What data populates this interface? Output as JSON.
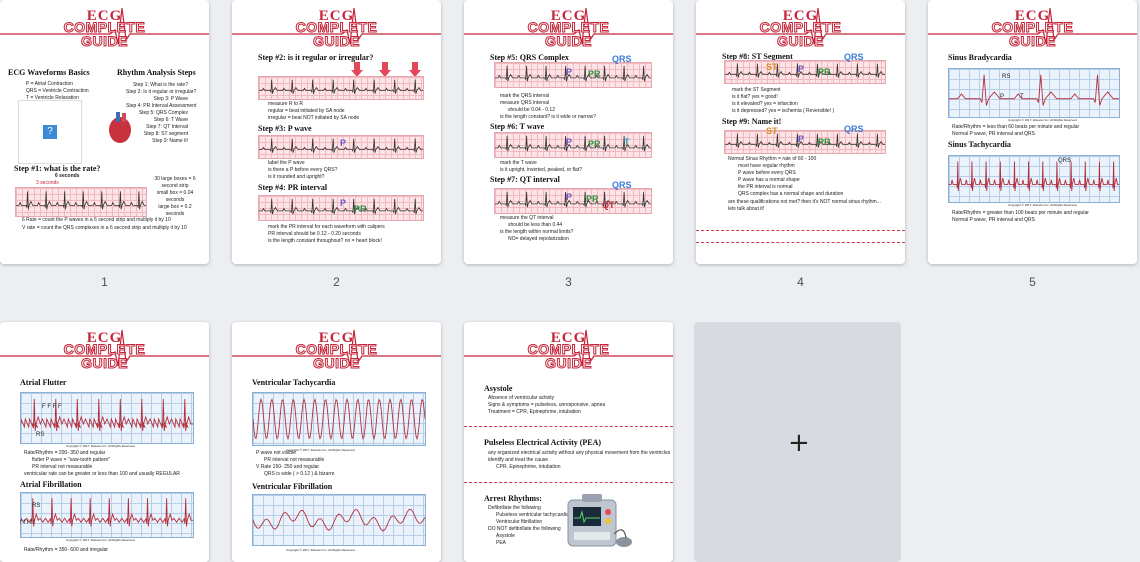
{
  "header": {
    "ecg": "ECG",
    "complete": "COMPLETE",
    "guide": "GUIDE"
  },
  "page_numbers": [
    "1",
    "2",
    "3",
    "4",
    "5"
  ],
  "add_page": {
    "icon": "plus-icon",
    "symbol": "+"
  },
  "colors": {
    "accent": "#c5263a",
    "background": "#eceef2",
    "add_tile": "#d7dbe1"
  },
  "p1": {
    "left_title": "ECG Waveforms Basics",
    "left_lines": [
      "P = Atrial Contraction",
      "QRS = Ventricle Contraction",
      "T = Ventricle Relaxation"
    ],
    "right_title": "Rhythm Analysis Steps",
    "right_lines": [
      "Step 1: What is the rate?",
      "Step 2: Is it regular or irregular?",
      "Step 3: P Wave",
      "Step 4: PR Interval Assessment",
      "Step 5: QRS Complex",
      "Step 6: T Wave",
      "Step 7: QT Interval",
      "Step 8: ST segment",
      "Step 9: Name it!"
    ],
    "image_placeholder": "?",
    "step1": "Step #1: what is the rate?",
    "strip_label1": "6 seconds",
    "strip_label2": "3 seconds",
    "notes": [
      "30 large boxes = 6",
      "second strip",
      "small box = 0.04",
      "seconds",
      "large box = 0.2",
      "seconds"
    ],
    "bullets": [
      "6 Rate = count the P waves in a 6 second strip and multiply it by 10",
      "V rate = count the QRS complexes in a 6 second strip and multiply it by 10"
    ]
  },
  "p2": {
    "step2": "Step #2: is it regular or irregular?",
    "b2": [
      "measure R to R",
      "regular = beat initiated by SA node",
      "irregular = beat NOT initiated by SA node"
    ],
    "step3": "Step #3: P wave",
    "b3": [
      "label the P wave",
      "is there a P before every QRS?",
      "is it rounded and upright?"
    ],
    "step4": "Step #4: PR interval",
    "b4": [
      "mark the PR interval for each waveform with calipers",
      "PR interval should be 0.12 - 0.20 seconds",
      "is the length constant throughout? no = heart block!"
    ]
  },
  "p3": {
    "step5": "Step #5: QRS Complex",
    "b5": [
      "mark the QRS interval",
      "measure QRS interval",
      "should be 0.04 - 0.12",
      "is the length constant? is it wide or narrow?"
    ],
    "step6": "Step #6: T wave",
    "b6": [
      "mark the T wave",
      "is it upright, inverted, peaked, or flat?"
    ],
    "step7": "Step #7: QT interval",
    "b7": [
      "measure the QT interval",
      "should be less than 0.44",
      "is the length within normal limits?",
      "NO= delayed repolarization"
    ]
  },
  "p4": {
    "step8": "Step #8: ST Segment",
    "b8": [
      "mark the ST Segment",
      "is it flat? yes = good!",
      "is it elevated? yes = infarction",
      "is it depressed? yes = ischemia ( Reversible! )"
    ],
    "step9": "Step #9: Name it!",
    "b9": [
      "Normal Sinus Rhythm = rate of 60 - 100",
      "most have regular rhythm",
      "P wave before every QRS",
      "P wave has a normal shape",
      "the PR interval is normal",
      "QRS complex has a normal shape and duration",
      "are these qualifications not met? then it's NOT normal sinus rhythm... lets talk about it!"
    ]
  },
  "p5": {
    "title1": "Sinus Bradycardia",
    "b1": [
      "Rate/Rhythm = less than 60 beats per minute and regular",
      "Normal P wave, PR interval and QRS"
    ],
    "title2": "Sinus Tachycardia",
    "b2": [
      "Rate/Rhythm = greater than 100 beats per minute and regular",
      "Normal P wave, PR interval and QRS"
    ],
    "copyright": "Copyright © 2017, Elsevier Inc. All Rights Reserved.",
    "labels": {
      "rs": "RS",
      "p": "P",
      "t": "T",
      "qrs": "QRS"
    }
  },
  "p6": {
    "title1": "Atrial Flutter",
    "b1": [
      "Rate/Rhythm = 200- 350 and regular",
      "flutter P wave = \"saw-tooth pattern\"",
      "PR interval not measurable",
      "ventricular rate can be greater or less than 100 and usually REGULAR"
    ],
    "title2": "Atrial Fibrillation",
    "b2": [
      "Rate/Rhythm = 350- 600 and irregular"
    ],
    "copyright": "Copyright © 2017, Elsevier Inc. All Rights Reserved.",
    "labels": {
      "f": "F F F F",
      "rs": "RS",
      "fs": "f f f f f"
    }
  },
  "p7": {
    "title1": "Ventricular Tachycardia",
    "b1": [
      "P wave not visible",
      "PR interval not measurable",
      "V Rate 150- 250 and regular",
      "QRS is wide ( > 0.12 ) & bizarre"
    ],
    "title2": "Ventricular Fibrillation",
    "copyright": "Copyright © 2017, Elsevier Inc. All Rights Reserved."
  },
  "p8": {
    "title1": "Asystole",
    "b1": [
      "Absence of ventricular activity",
      "Signs & symptoms = pulseless, unresponsive, apnea",
      "Treatment = CPR, Epinephrine, intubation"
    ],
    "title2": "Pulseless Electrical Activity (PEA)",
    "b2": [
      "any organized electrical activity without any physical movement from the ventricles",
      "identify and treat the cause",
      "CPR, Epinephrine, intubation"
    ],
    "title3": "Arrest Rhythms:",
    "b3": [
      "Defibrillate the following",
      "Pulseless ventricular tachycardia",
      "Ventricular fibrillation",
      "DO NOT defibrillate the following",
      "Asystole",
      "PEA"
    ]
  },
  "wave_labels": {
    "p": "P",
    "pr": "PR",
    "qrs": "QRS",
    "qt": "QT",
    "st": "ST",
    "t": "T"
  }
}
